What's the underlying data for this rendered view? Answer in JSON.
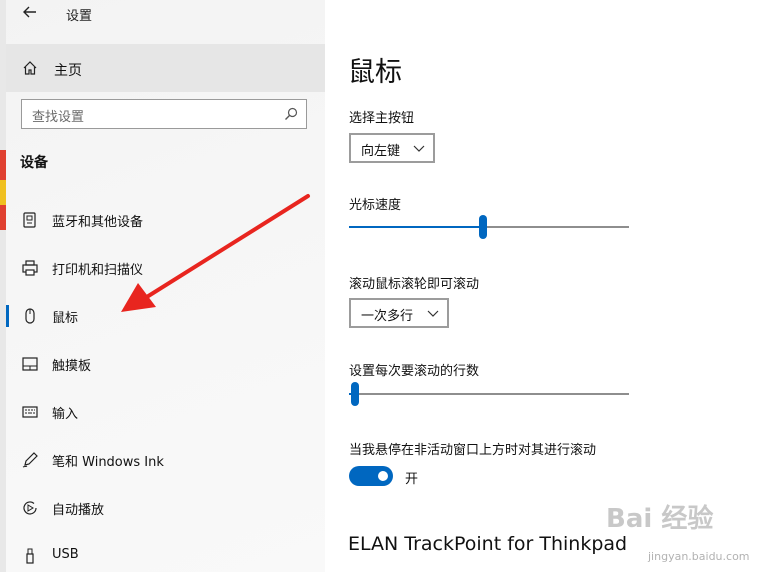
{
  "window": {
    "title": "设置",
    "back_icon": "back-arrow-icon"
  },
  "sidebar": {
    "home_label": "主页",
    "search_placeholder": "查找设置",
    "section_title": "设备",
    "items": [
      {
        "label": "蓝牙和其他设备",
        "icon": "bluetooth-devices-icon"
      },
      {
        "label": "打印机和扫描仪",
        "icon": "printer-icon"
      },
      {
        "label": "鼠标",
        "icon": "mouse-icon",
        "selected": true
      },
      {
        "label": "触摸板",
        "icon": "touchpad-icon"
      },
      {
        "label": "输入",
        "icon": "keyboard-icon"
      },
      {
        "label": "笔和 Windows Ink",
        "icon": "pen-icon"
      },
      {
        "label": "自动播放",
        "icon": "autoplay-icon"
      },
      {
        "label": "USB",
        "icon": "usb-icon"
      }
    ]
  },
  "main": {
    "title": "鼠标",
    "primary_button": {
      "label": "选择主按钮",
      "value": "向左键"
    },
    "cursor_speed": {
      "label": "光标速度",
      "level": 0.48
    },
    "scroll_mode": {
      "label": "滚动鼠标滚轮即可滚动",
      "value": "一次多行"
    },
    "scroll_lines": {
      "label": "设置每次要滚动的行数",
      "level": 0.02
    },
    "inactive_scroll": {
      "label": "当我悬停在非活动窗口上方时对其进行滚动",
      "state_label": "开",
      "on": true
    },
    "device_title": "ELAN TrackPoint for Thinkpad"
  },
  "watermark": {
    "text": "Bai 经验",
    "sub": "jingyan.baidu.com"
  },
  "colors": {
    "accent": "#0067c0",
    "annotation_arrow": "#e8251f"
  }
}
